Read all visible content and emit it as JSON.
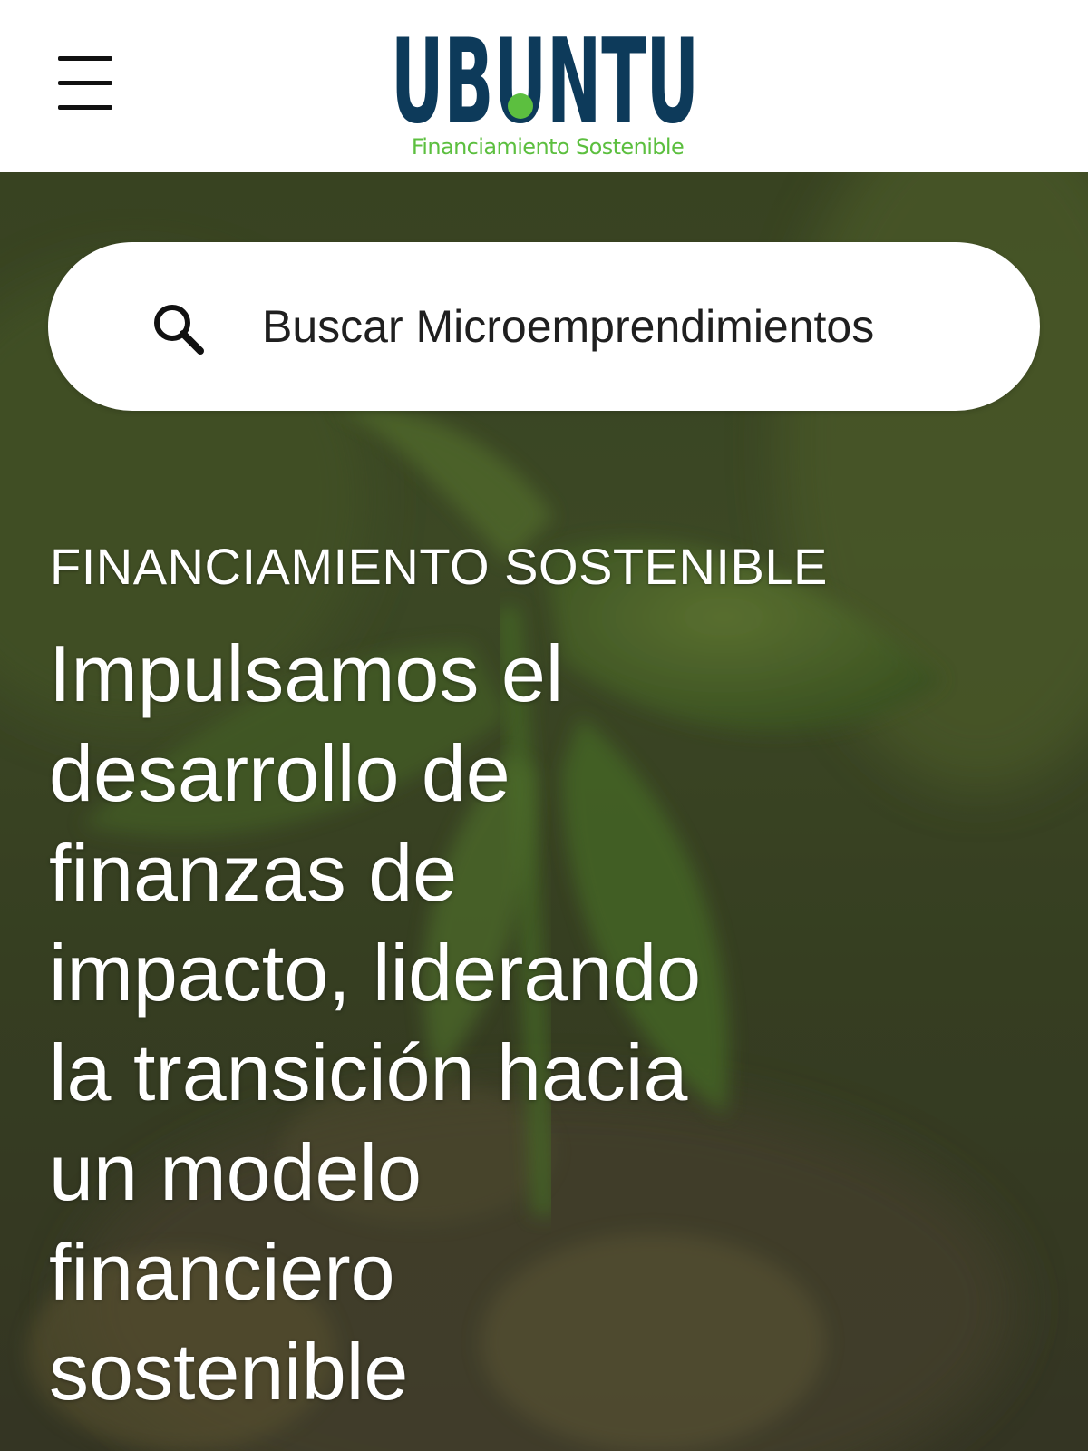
{
  "header": {
    "menu_icon": "hamburger-menu-icon",
    "logo": {
      "wordmark": "UBUNTU",
      "tagline": "Financiamiento Sostenible",
      "wordmark_color": "#0d3a5a",
      "accent_color": "#5cbf3f"
    }
  },
  "search": {
    "icon": "search-icon",
    "placeholder": "Buscar Microemprendimientos"
  },
  "hero": {
    "eyebrow": "FINANCIAMIENTO SOSTENIBLE",
    "headline_lines": [
      "Impulsamos el",
      "desarrollo de",
      "finanzas de",
      "impacto, liderando",
      "la transición hacia",
      "un modelo",
      "financiero",
      "sostenible"
    ],
    "text_color": "#ffffff"
  }
}
